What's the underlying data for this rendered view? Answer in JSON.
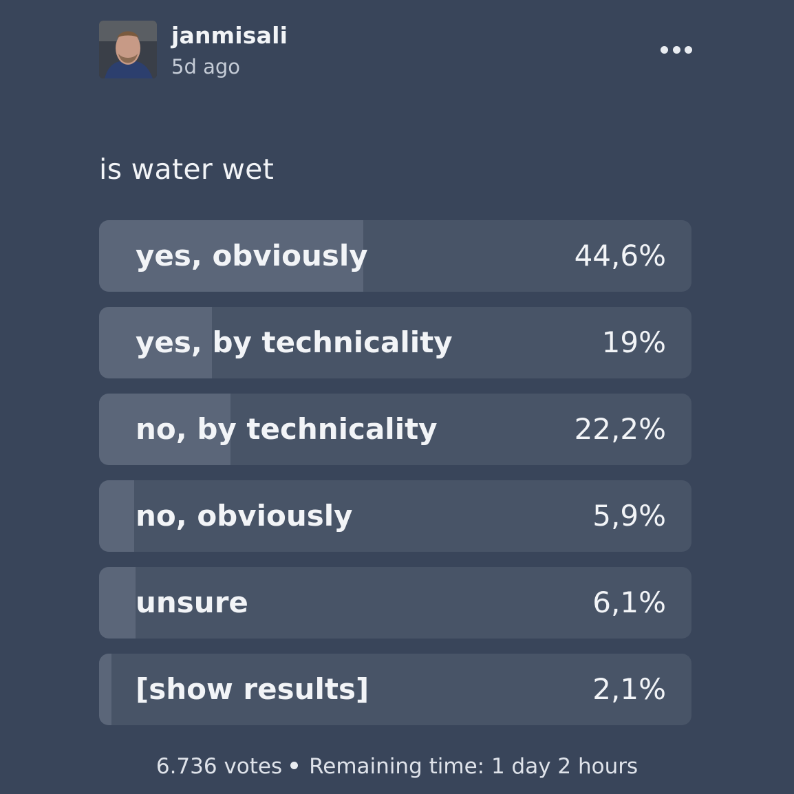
{
  "post": {
    "author": "janmisali",
    "timestamp": "5d ago",
    "menu_icon": "more-horizontal-icon"
  },
  "poll": {
    "question": "is water wet",
    "options": [
      {
        "label": "yes, obviously",
        "percent_text": "44,6%",
        "share": 0.446
      },
      {
        "label": "yes, by technicality",
        "percent_text": "19%",
        "share": 0.19
      },
      {
        "label": "no, by technicality",
        "percent_text": "22,2%",
        "share": 0.222
      },
      {
        "label": "no, obviously",
        "percent_text": "5,9%",
        "share": 0.059
      },
      {
        "label": "unsure",
        "percent_text": "6,1%",
        "share": 0.061
      },
      {
        "label": "[show results]",
        "percent_text": "2,1%",
        "share": 0.021
      }
    ],
    "votes": "6.736 votes",
    "remaining": "Remaining time: 1 day 2 hours"
  },
  "colors": {
    "background": "#39455a",
    "option_track": "#485467",
    "option_fill": "#5b6679",
    "text": "#f2f4f7"
  }
}
